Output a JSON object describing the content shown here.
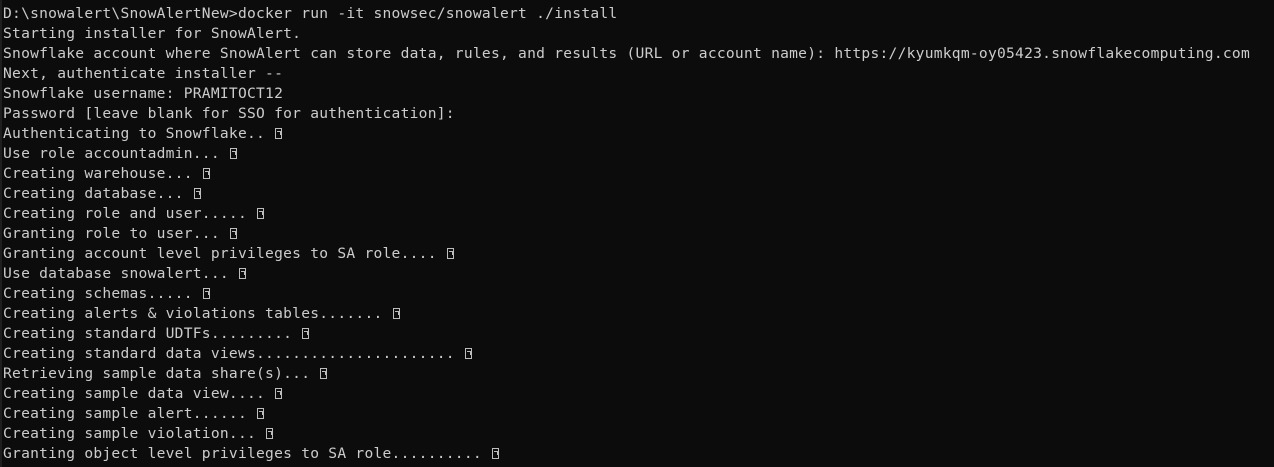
{
  "terminal": {
    "background": "#0c0c0c",
    "foreground": "#cccccc",
    "lines": [
      {
        "text": "D:\\snowalert\\SnowAlertNew>docker run -it snowsec/snowalert ./install",
        "has_glyph": false
      },
      {
        "text": "Starting installer for SnowAlert.",
        "has_glyph": false
      },
      {
        "text": "Snowflake account where SnowAlert can store data, rules, and results (URL or account name): https://kyumkqm-oy05423.snowflakecomputing.com",
        "has_glyph": false
      },
      {
        "text": "Next, authenticate installer --",
        "has_glyph": false
      },
      {
        "text": "Snowflake username: PRAMITOCT12",
        "has_glyph": false
      },
      {
        "text": "Password [leave blank for SSO for authentication]:",
        "has_glyph": false
      },
      {
        "text": "Authenticating to Snowflake.. ",
        "has_glyph": true
      },
      {
        "text": "Use role accountadmin... ",
        "has_glyph": true
      },
      {
        "text": "Creating warehouse... ",
        "has_glyph": true
      },
      {
        "text": "Creating database... ",
        "has_glyph": true
      },
      {
        "text": "Creating role and user..... ",
        "has_glyph": true
      },
      {
        "text": "Granting role to user... ",
        "has_glyph": true
      },
      {
        "text": "Granting account level privileges to SA role.... ",
        "has_glyph": true
      },
      {
        "text": "Use database snowalert... ",
        "has_glyph": true
      },
      {
        "text": "Creating schemas..... ",
        "has_glyph": true
      },
      {
        "text": "Creating alerts & violations tables....... ",
        "has_glyph": true
      },
      {
        "text": "Creating standard UDTFs......... ",
        "has_glyph": true
      },
      {
        "text": "Creating standard data views...................... ",
        "has_glyph": true
      },
      {
        "text": "Retrieving sample data share(s)... ",
        "has_glyph": true
      },
      {
        "text": "Creating sample data view.... ",
        "has_glyph": true
      },
      {
        "text": "Creating sample alert...... ",
        "has_glyph": true
      },
      {
        "text": "Creating sample violation... ",
        "has_glyph": true
      },
      {
        "text": "Granting object level privileges to SA role.......... ",
        "has_glyph": true
      }
    ]
  },
  "icons": {
    "missing_glyph": "unrenderable-checkmark-icon"
  }
}
